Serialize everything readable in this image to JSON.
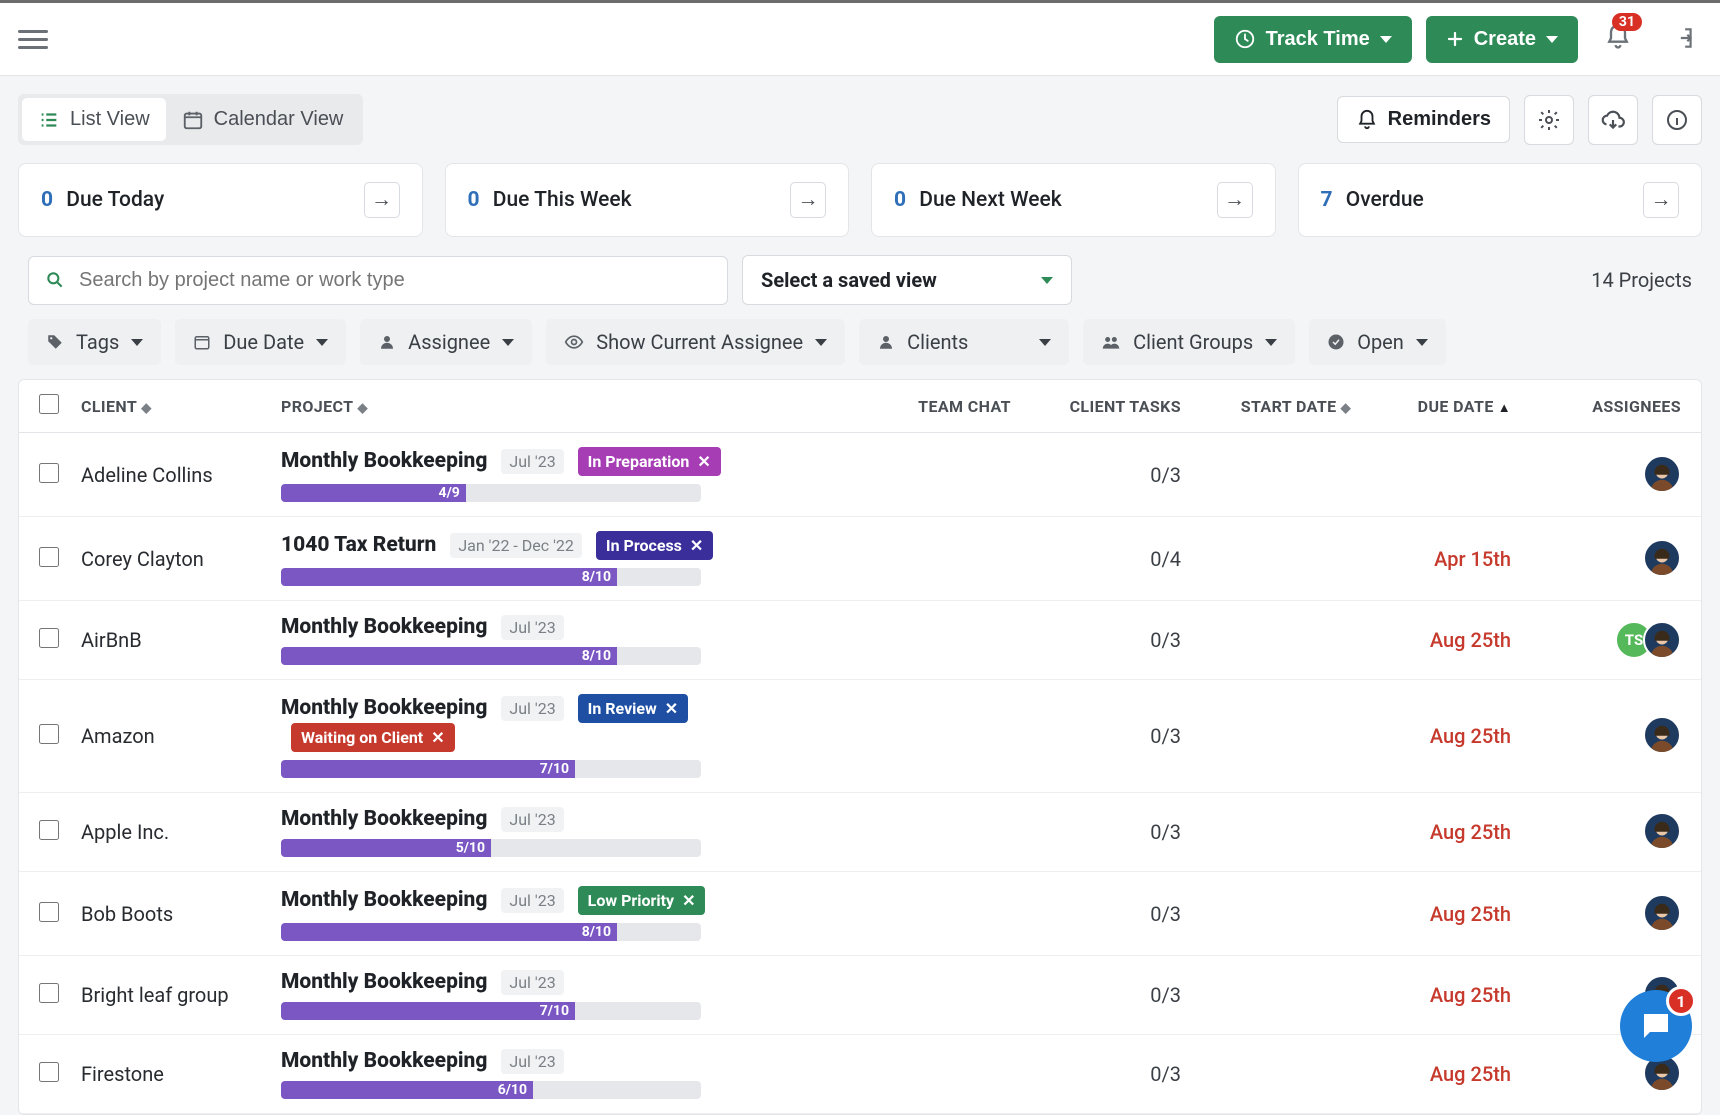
{
  "header": {
    "track_time_label": "Track Time",
    "create_label": "Create",
    "notification_count": "31"
  },
  "views": {
    "list": "List View",
    "calendar": "Calendar View"
  },
  "tools": {
    "reminders": "Reminders"
  },
  "cards": [
    {
      "count": "0",
      "label": "Due Today"
    },
    {
      "count": "0",
      "label": "Due This Week"
    },
    {
      "count": "0",
      "label": "Due Next Week"
    },
    {
      "count": "7",
      "label": "Overdue"
    }
  ],
  "search": {
    "placeholder": "Search by project name or work type",
    "saved_view_label": "Select a saved view",
    "project_count_label": "14 Projects"
  },
  "filters": {
    "tags": "Tags",
    "due_date": "Due Date",
    "assignee": "Assignee",
    "show_current": "Show Current Assignee",
    "clients": "Clients",
    "client_groups": "Client Groups",
    "open": "Open"
  },
  "columns": {
    "client": "CLIENT",
    "project": "PROJECT",
    "team_chat": "TEAM CHAT",
    "client_tasks": "CLIENT TASKS",
    "start_date": "START DATE",
    "due_date": "DUE DATE",
    "assignees": "ASSIGNEES"
  },
  "tag_colors": {
    "In Preparation": "#a63db5",
    "In Process": "#3a2f9a",
    "In Review": "#1e4fa3",
    "Waiting on Client": "#c63a2e",
    "Low Priority": "#2e8b57"
  },
  "rows": [
    {
      "client": "Adeline Collins",
      "project": "Monthly Bookkeeping",
      "period": "Jul '23",
      "tags": [
        "In Preparation"
      ],
      "progress_text": "4/9",
      "progress_pct": 44,
      "tasks": "0/3",
      "due": "",
      "assignees": [
        "photo"
      ]
    },
    {
      "client": "Corey Clayton",
      "project": "1040 Tax Return",
      "period": "Jan '22 - Dec '22",
      "tags": [
        "In Process"
      ],
      "progress_text": "8/10",
      "progress_pct": 80,
      "tasks": "0/4",
      "due": "Apr 15th",
      "assignees": [
        "photo"
      ]
    },
    {
      "client": "AirBnB",
      "project": "Monthly Bookkeeping",
      "period": "Jul '23",
      "tags": [],
      "progress_text": "8/10",
      "progress_pct": 80,
      "tasks": "0/3",
      "due": "Aug 25th",
      "assignees": [
        "TS",
        "photo"
      ]
    },
    {
      "client": "Amazon",
      "project": "Monthly Bookkeeping",
      "period": "Jul '23",
      "tags": [
        "In Review",
        "Waiting on Client"
      ],
      "progress_text": "7/10",
      "progress_pct": 70,
      "tasks": "0/3",
      "due": "Aug 25th",
      "assignees": [
        "photo"
      ]
    },
    {
      "client": "Apple Inc.",
      "project": "Monthly Bookkeeping",
      "period": "Jul '23",
      "tags": [],
      "progress_text": "5/10",
      "progress_pct": 50,
      "tasks": "0/3",
      "due": "Aug 25th",
      "assignees": [
        "photo"
      ]
    },
    {
      "client": "Bob Boots",
      "project": "Monthly Bookkeeping",
      "period": "Jul '23",
      "tags": [
        "Low Priority"
      ],
      "progress_text": "8/10",
      "progress_pct": 80,
      "tasks": "0/3",
      "due": "Aug 25th",
      "assignees": [
        "photo"
      ]
    },
    {
      "client": "Bright leaf group",
      "project": "Monthly Bookkeeping",
      "period": "Jul '23",
      "tags": [],
      "progress_text": "7/10",
      "progress_pct": 70,
      "tasks": "0/3",
      "due": "Aug 25th",
      "assignees": [
        "photo"
      ]
    },
    {
      "client": "Firestone",
      "project": "Monthly Bookkeeping",
      "period": "Jul '23",
      "tags": [],
      "progress_text": "6/10",
      "progress_pct": 60,
      "tasks": "0/3",
      "due": "Aug 25th",
      "assignees": [
        "photo"
      ]
    }
  ],
  "chat_badge": "1"
}
